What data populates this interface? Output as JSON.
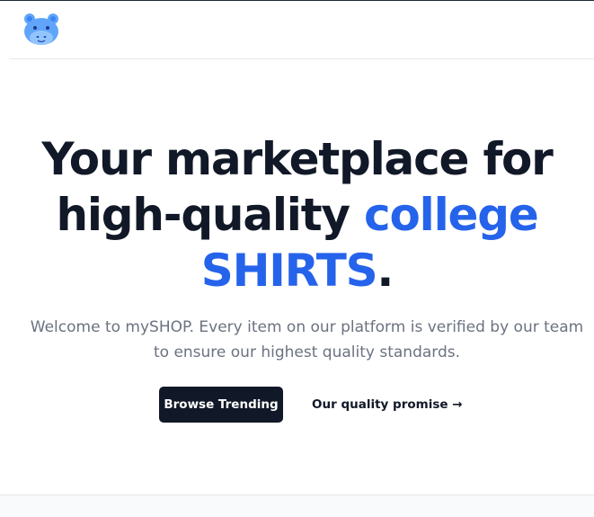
{
  "navbar": {
    "logo_icon": "hippo-logo-icon",
    "logo_color": "#60a5fa"
  },
  "hero": {
    "headline_part1": "Your marketplace for high-quality ",
    "headline_accent1": "college",
    "headline_accent2": "SHIRTS",
    "headline_end": ".",
    "subtitle": "Welcome to mySHOP. Every item on our platform is verified by our team to ensure our highest quality standards.",
    "primary_button": "Browse Trending",
    "secondary_link": "Our quality promise →",
    "accent_color": "#2563eb",
    "dark_color": "#111827"
  }
}
